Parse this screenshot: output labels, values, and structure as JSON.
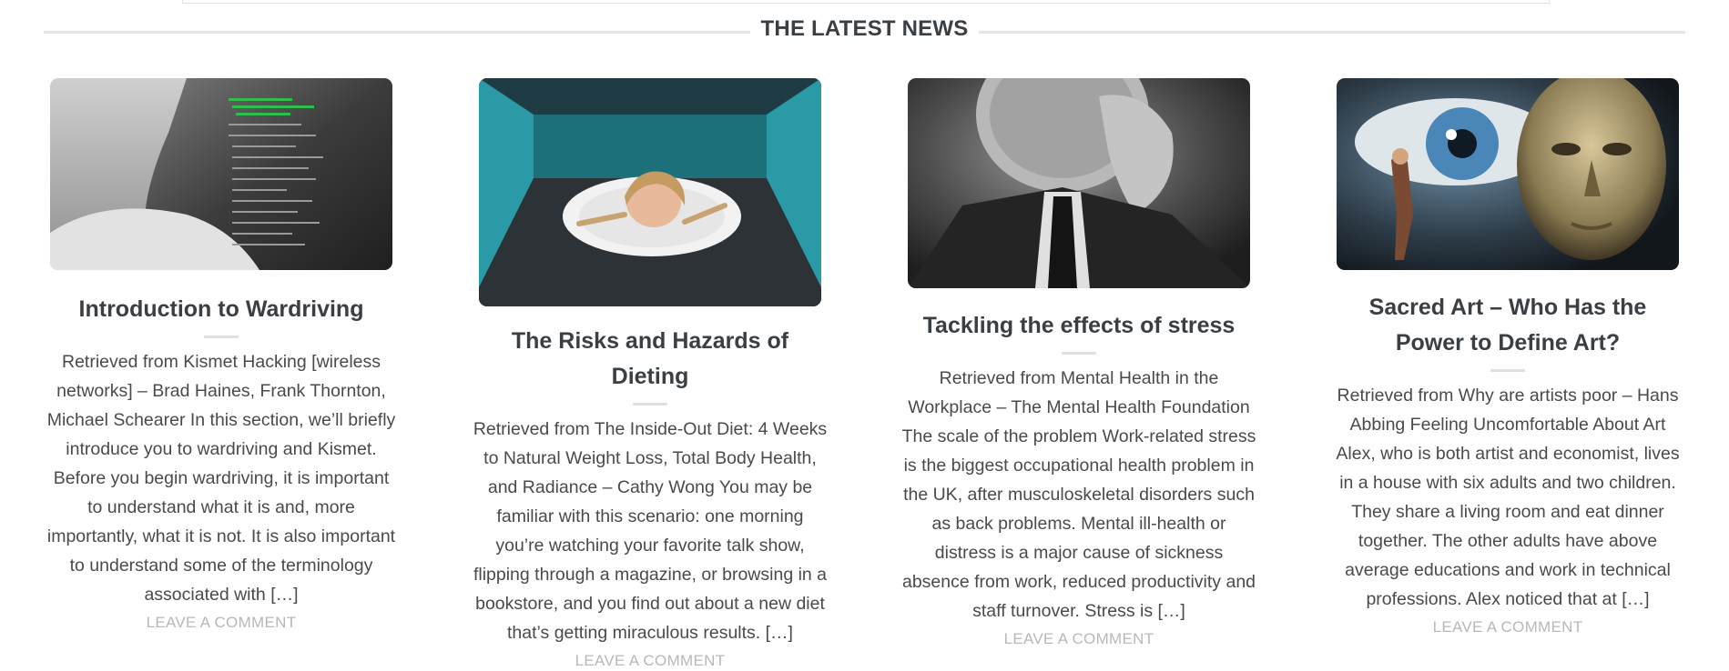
{
  "section": {
    "heading": "THE LATEST NEWS"
  },
  "posts": [
    {
      "title": "Introduction to Wardriving",
      "excerpt": "Retrieved from Kismet Hacking [wireless networks] – Brad Haines, Frank Thornton, Michael Schearer In this section, we’ll briefly introduce you to wardriving and Kismet. Before you begin wardriving, it is important to understand what it is and, more importantly, what it is not. It is also important to understand some of the terminology associated with […]",
      "comment_label": "LEAVE A COMMENT"
    },
    {
      "title": "The Risks and Hazards of Dieting",
      "excerpt": "Retrieved from The Inside-Out Diet: 4 Weeks to Natural Weight Loss, Total Body Health, and Radiance – Cathy Wong You may be familiar with this scenario: one morning you’re watching your favorite talk show, flipping through a magazine, or browsing in a bookstore, and you find out about a new diet that’s getting miraculous results. […]",
      "comment_label": "LEAVE A COMMENT"
    },
    {
      "title": "Tackling the effects of stress",
      "excerpt": "Retrieved from Mental Health in the Workplace – The Mental Health Foundation The scale of the problem Work-related stress is the biggest occupational health problem in the UK, after musculoskeletal disorders such as back problems. Mental ill-health or distress is a major cause of sickness absence from work, reduced productivity and staff turnover. Stress is […]",
      "comment_label": "LEAVE A COMMENT"
    },
    {
      "title": "Sacred Art – Who Has the Power to Define Art?",
      "excerpt": "Retrieved from Why are artists poor – Hans Abbing Feeling Uncomfortable About Art Alex, who is both artist and economist, lives in a house with six adults and two children. They share a living room and eat dinner together. The other adults have above average educations and work in technical professions. Alex noticed that at […]",
      "comment_label": "LEAVE A COMMENT"
    }
  ],
  "colors": {
    "heading": "#3a3f44",
    "text": "#4a4a4a",
    "muted": "#b8b8b8",
    "rule": "#e4e4e4"
  }
}
